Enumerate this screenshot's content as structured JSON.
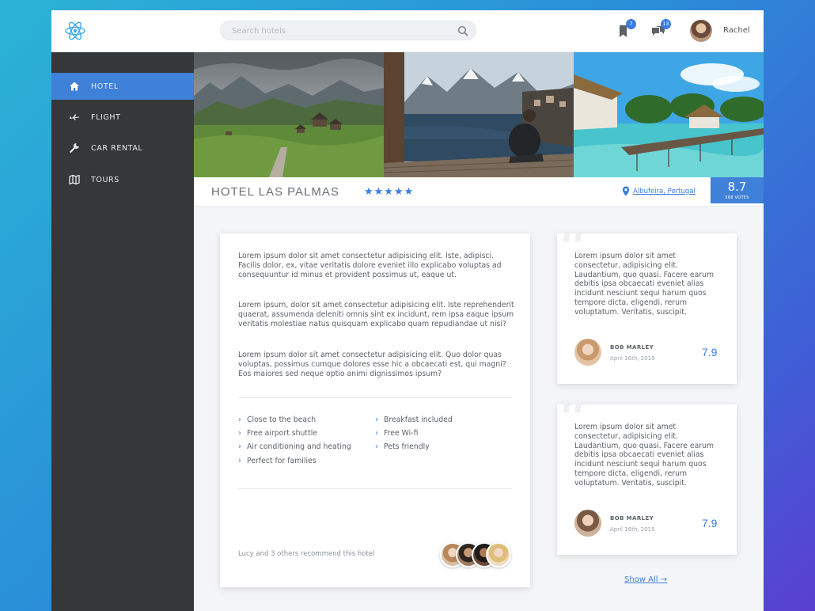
{
  "search": {
    "placeholder": "Search hotels"
  },
  "topbar": {
    "bookmark_badge": "7",
    "messages_badge": "13",
    "username": "Rachel"
  },
  "sidebar": {
    "items": [
      {
        "label": "HOTEL",
        "icon": "home-icon",
        "active": true
      },
      {
        "label": "FLIGHT",
        "icon": "plane-icon",
        "active": false
      },
      {
        "label": "CAR RENTAL",
        "icon": "wrench-icon",
        "active": false
      },
      {
        "label": "TOURS",
        "icon": "map-icon",
        "active": false
      }
    ]
  },
  "hotel": {
    "name": "HOTEL LAS PALMAS",
    "stars": "★★★★★",
    "location": "Albufeira, Portugal",
    "score": "8.7",
    "votes": "568 VOTES"
  },
  "description": {
    "paragraphs": [
      "Lorem ipsum dolor sit amet consectetur adipisicing elit. Iste, adipisci. Facilis dolor, ex, vitae veritatis dolore eveniet illo explicabo voluptas ad consequuntur id minus et provident possimus ut, eaque ut.",
      "Lorem ipsum, dolor sit amet consectetur adipisicing elit. Iste reprehenderit quaerat, assumenda deleniti omnis sint ex incidunt, rem ipsa eaque ipsum veritatis molestiae natus quisquam explicabo quam repudiandae ut nisi?",
      "Lorem ipsum dolor sit amet consectetur adipisicing elit. Quo dolor quas voluptas, possimus cumque dolores esse hic a obcaecati est, qui magni? Eos maiores sed neque optio animi dignissimos ipsum?"
    ],
    "amenities_left": [
      "Close to the beach",
      "Free airport shuttle",
      "Air conditioning and heating",
      "Perfect for families"
    ],
    "amenities_right": [
      "Breakfast included",
      "Free Wi-fi",
      "Pets friendly"
    ],
    "recommend": "Lucy and 3 others recommend this hotel"
  },
  "reviews": [
    {
      "text": "Lorem ipsum dolor sit amet consectetur, adipisicing elit. Laudantium, quo quasi. Facere earum debitis ipsa obcaecati eveniet alias incidunt nesciunt sequi harum quos tempore dicta, eligendi, rerum voluptatum. Veritatis, suscipit.",
      "name": "BOB MARLEY",
      "date": "April 16th, 2019",
      "score": "7.9"
    },
    {
      "text": "Lorem ipsum dolor sit amet consectetur, adipisicing elit. Laudantium, quo quasi. Facere earum debitis ipsa obcaecati eveniet alias incidunt nesciunt sequi harum quos tempore dicta, eligendi, rerum voluptatum. Veritatis, suscipit.",
      "name": "BOB MARLEY",
      "date": "April 16th, 2019",
      "score": "7.9"
    }
  ],
  "show_all": "Show All →",
  "colors": {
    "accent": "#3f80d8",
    "sidebar": "#353738",
    "background_gradient": [
      "#2bb3d6",
      "#5a3fd0"
    ]
  }
}
